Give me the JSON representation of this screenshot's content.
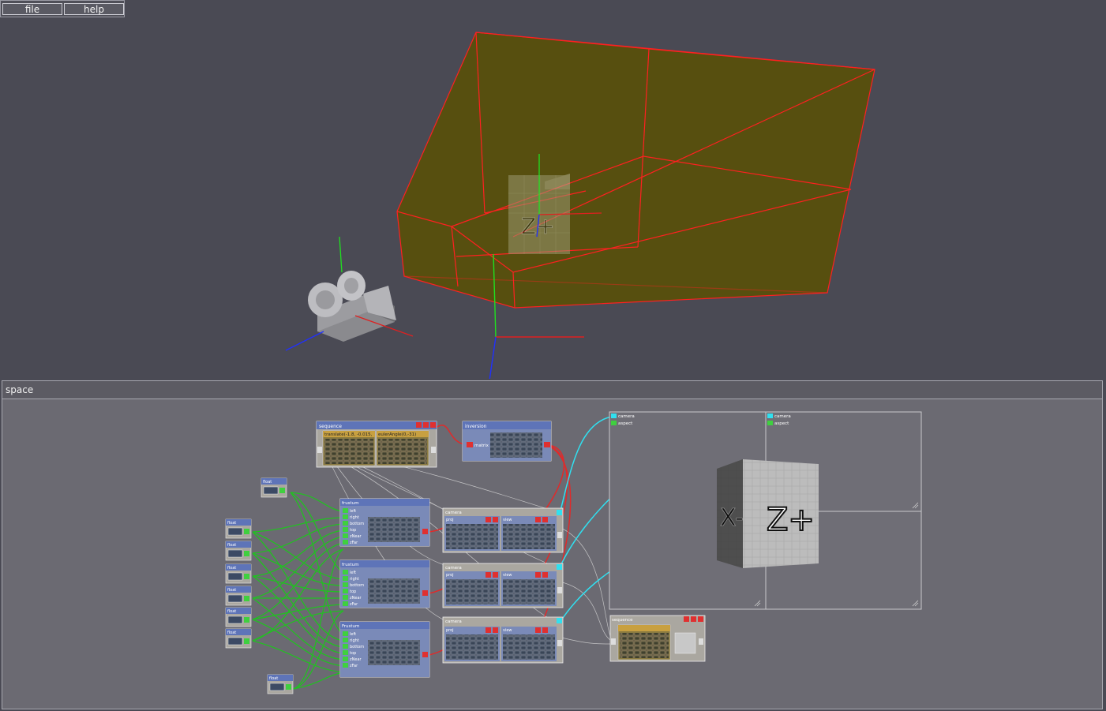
{
  "menu": {
    "file": "file",
    "help": "help"
  },
  "panel": {
    "title": "space"
  },
  "node_titles": {
    "sequence": "sequence",
    "inversion": "inversion",
    "float": "float",
    "frustum": "frustum",
    "camera": "camera",
    "proj": "proj",
    "view": "view",
    "Frustum": "Frustum"
  },
  "fields": {
    "translate": "translate(-1.8, -0.015,",
    "eulerAngle": "eulerAngle(0,-31)",
    "matrix": "matrix",
    "aspect": "aspect",
    "frustum_params": [
      "left",
      "right",
      "bottom",
      "top",
      "zNear",
      "zFar"
    ]
  },
  "preview": {
    "x_face": "X-",
    "z_face": "Z+"
  },
  "colors": {
    "background": "#4a4a54",
    "frustum_fill": "#5a5000",
    "frustum_edge": "#ff2020",
    "axis_x": "#e02020",
    "axis_y": "#20e020",
    "axis_z": "#2030ff",
    "wire_green": "#22c022",
    "wire_red": "#e02a2a",
    "wire_cyan": "#30e0f0",
    "node_header": "#5e74b8"
  },
  "icons": [
    "camera-icon",
    "port-in-icon",
    "port-out-icon",
    "node-minimize-icon",
    "node-close-icon"
  ]
}
